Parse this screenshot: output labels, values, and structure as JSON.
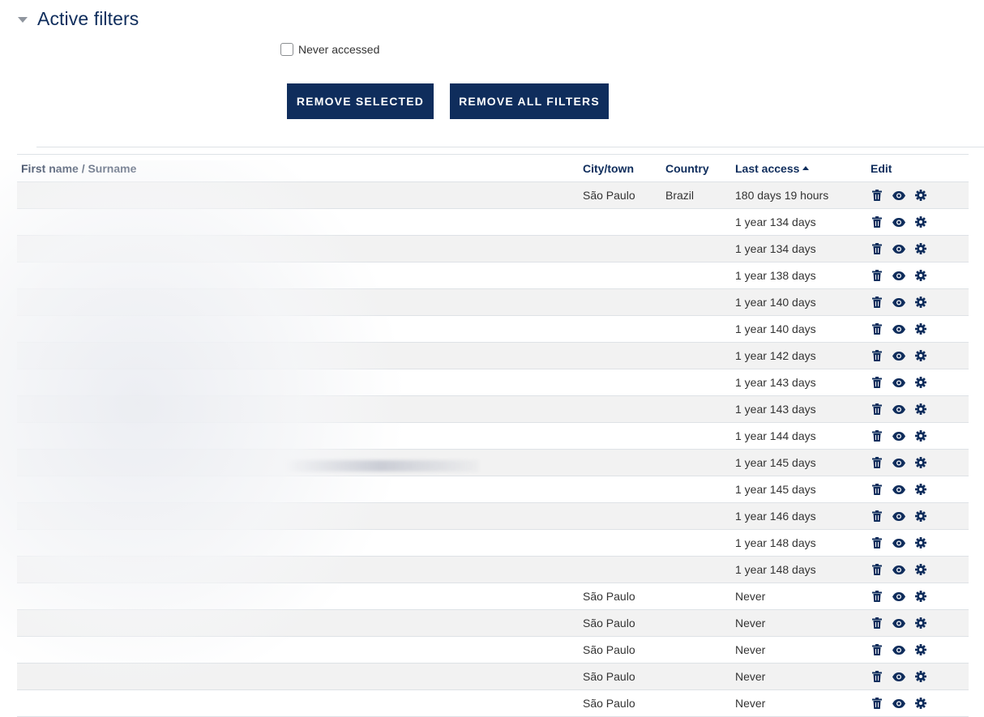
{
  "section": {
    "title": "Active filters"
  },
  "filters": [
    {
      "label": "Never accessed",
      "checked": false
    }
  ],
  "buttons": {
    "remove_selected": "REMOVE SELECTED",
    "remove_all": "REMOVE ALL FILTERS"
  },
  "table": {
    "headers": {
      "name": "First name / Surname",
      "city": "City/town",
      "country": "Country",
      "last_access": "Last access",
      "edit": "Edit"
    },
    "sort_column": "last_access",
    "sort_direction": "ascending",
    "rows": [
      {
        "city": "São Paulo",
        "country": "Brazil",
        "last_access": "180 days 19 hours"
      },
      {
        "city": "",
        "country": "",
        "last_access": "1 year 134 days"
      },
      {
        "city": "",
        "country": "",
        "last_access": "1 year 134 days"
      },
      {
        "city": "",
        "country": "",
        "last_access": "1 year 138 days"
      },
      {
        "city": "",
        "country": "",
        "last_access": "1 year 140 days"
      },
      {
        "city": "",
        "country": "",
        "last_access": "1 year 140 days"
      },
      {
        "city": "",
        "country": "",
        "last_access": "1 year 142 days"
      },
      {
        "city": "",
        "country": "",
        "last_access": "1 year 143 days"
      },
      {
        "city": "",
        "country": "",
        "last_access": "1 year 143 days"
      },
      {
        "city": "",
        "country": "",
        "last_access": "1 year 144 days"
      },
      {
        "city": "",
        "country": "",
        "last_access": "1 year 145 days"
      },
      {
        "city": "",
        "country": "",
        "last_access": "1 year 145 days"
      },
      {
        "city": "",
        "country": "",
        "last_access": "1 year 146 days"
      },
      {
        "city": "",
        "country": "",
        "last_access": "1 year 148 days"
      },
      {
        "city": "",
        "country": "",
        "last_access": "1 year 148 days"
      },
      {
        "city": "São Paulo",
        "country": "",
        "last_access": "Never"
      },
      {
        "city": "São Paulo",
        "country": "",
        "last_access": "Never"
      },
      {
        "city": "São Paulo",
        "country": "",
        "last_access": "Never"
      },
      {
        "city": "São Paulo",
        "country": "",
        "last_access": "Never"
      },
      {
        "city": "São Paulo",
        "country": "",
        "last_access": "Never"
      }
    ]
  },
  "icons": {
    "delete": "trash-icon",
    "view": "eye-icon",
    "settings": "gear-icon"
  },
  "colors": {
    "brand": "#0f2d5c",
    "row_stripe": "#f2f2f2",
    "border": "#dee2e6"
  }
}
